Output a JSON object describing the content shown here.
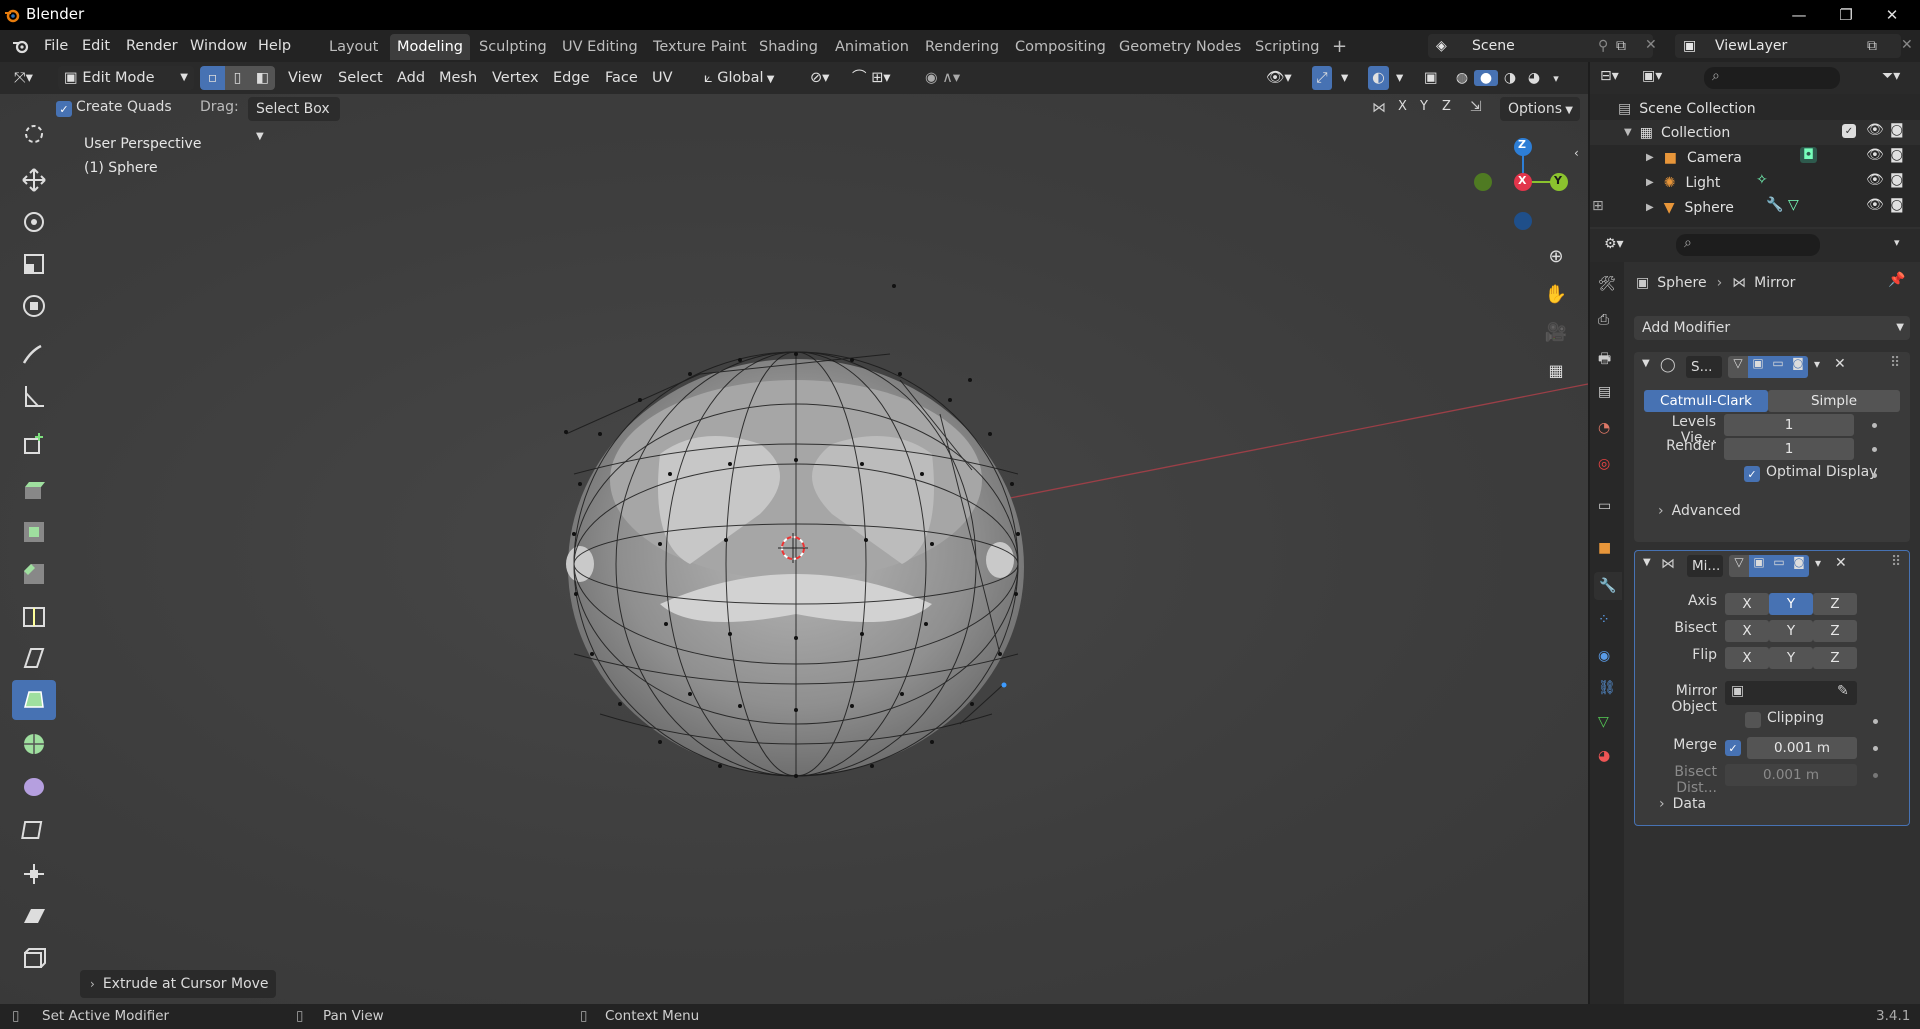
{
  "app": {
    "title": "Blender",
    "version": "3.4.1"
  },
  "menus": [
    "File",
    "Edit",
    "Render",
    "Window",
    "Help"
  ],
  "workspaces": [
    "Layout",
    "Modeling",
    "Sculpting",
    "UV Editing",
    "Texture Paint",
    "Shading",
    "Animation",
    "Rendering",
    "Compositing",
    "Geometry Nodes",
    "Scripting"
  ],
  "active_workspace": "Modeling",
  "scene": {
    "name": "Scene",
    "view_layer": "ViewLayer"
  },
  "viewport_header": {
    "mode": "Edit Mode",
    "menus": [
      "View",
      "Select",
      "Add",
      "Mesh",
      "Vertex",
      "Edge",
      "Face",
      "UV"
    ],
    "orientation": "Global",
    "axes": [
      "X",
      "Y",
      "Z"
    ]
  },
  "tool_settings": {
    "create_quads_label": "Create Quads",
    "drag_label": "Drag:",
    "drag_value": "Select Box",
    "options_label": "Options"
  },
  "viewport": {
    "perspective": "User Perspective",
    "object": "(1) Sphere",
    "gizmo": {
      "z": "Z",
      "x": "X",
      "y": "Y"
    }
  },
  "last_operator": "Extrude at Cursor Move",
  "outliner": {
    "root": "Scene Collection",
    "collection": "Collection",
    "items": [
      "Camera",
      "Light",
      "Sphere"
    ]
  },
  "properties": {
    "breadcrumb": {
      "object": "Sphere",
      "modifier": "Mirror"
    },
    "add_modifier": "Add Modifier",
    "subsurf": {
      "name": "S...",
      "types": [
        "Catmull-Clark",
        "Simple"
      ],
      "levels_label": "Levels Vie...",
      "levels_value": "1",
      "render_label": "Render",
      "render_value": "1",
      "optimal_display": "Optimal Display",
      "advanced": "Advanced"
    },
    "mirror": {
      "name": "Mi...",
      "axis_label": "Axis",
      "bisect_label": "Bisect",
      "flip_label": "Flip",
      "xyz": [
        "X",
        "Y",
        "Z"
      ],
      "mirror_object_label": "Mirror Object",
      "clipping_label": "Clipping",
      "merge_label": "Merge",
      "merge_value": "0.001 m",
      "bisect_dist_label": "Bisect Dist...",
      "bisect_dist_value": "0.001 m",
      "data_label": "Data"
    }
  },
  "statusbar": {
    "left": "Set Active Modifier",
    "middle": "Pan View",
    "right": "Context Menu"
  },
  "colors": {
    "accent": "#4772b3",
    "axis_x": "#e2354b",
    "axis_y": "#8bc32e",
    "axis_z": "#2d7ed6"
  }
}
